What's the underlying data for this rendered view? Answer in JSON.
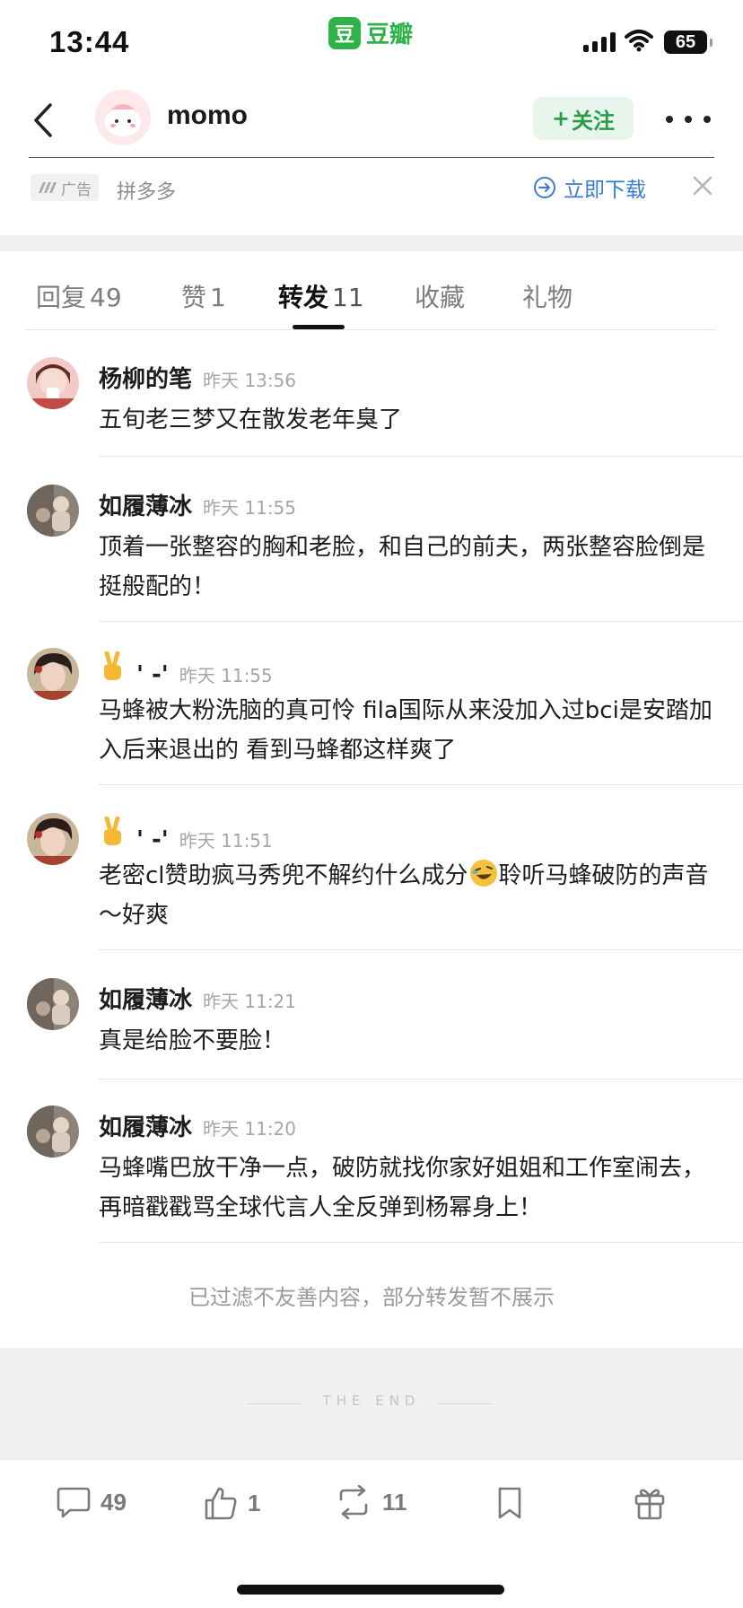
{
  "status_bar": {
    "time": "13:44",
    "app_brand": "豆瓣",
    "app_logo": "豆",
    "battery": "65"
  },
  "nav": {
    "user_name": "momo",
    "follow_label": "关注",
    "follow_plus": "+"
  },
  "ad": {
    "tag_label": "广告",
    "advertiser": "拼多多",
    "download_label": "立即下载"
  },
  "tabs": [
    {
      "label": "回复",
      "count": "49"
    },
    {
      "label": "赞",
      "count": "1"
    },
    {
      "label": "转发",
      "count": "11"
    },
    {
      "label": "收藏",
      "count": ""
    },
    {
      "label": "礼物",
      "count": ""
    }
  ],
  "active_tab": "转发",
  "comments": [
    {
      "user": "杨柳的笔",
      "time": "昨天 13:56",
      "text": "五旬老三梦又在散发老年臭了"
    },
    {
      "user": "如履薄冰",
      "time": "昨天 11:55",
      "text": "顶着一张整容的胸和老脸，和自己的前夫，两张整容脸倒是挺般配的！"
    },
    {
      "user": "' -'",
      "time": "昨天 11:55",
      "text": "马蜂被大粉洗脑的真可怜 fila国际从来没加入过bci是安踏加入后来退出的 看到马蜂都这样爽了"
    },
    {
      "user": "' -'",
      "time": "昨天 11:51",
      "text_before": "老密cl赞助疯马秀兜不解约什么成分",
      "text_after": "聆听马蜂破防的声音～好爽"
    },
    {
      "user": "如履薄冰",
      "time": "昨天 11:21",
      "text": "真是给脸不要脸！"
    },
    {
      "user": "如履薄冰",
      "time": "昨天 11:20",
      "text": "马蜂嘴巴放干净一点，破防就找你家好姐姐和工作室闹去，再暗戳戳骂全球代言人全反弹到杨幂身上！"
    }
  ],
  "filtered_notice": "已过滤不友善内容，部分转发暂不展示",
  "end_text": "THE END",
  "actions": {
    "comment_count": "49",
    "like_count": "1",
    "repost_count": "11"
  },
  "colors": {
    "brand_green": "#2fb24a",
    "follow_bg": "#e8f5ec",
    "link_blue": "#3a7bd5",
    "band_gray": "#f0f0f0"
  }
}
